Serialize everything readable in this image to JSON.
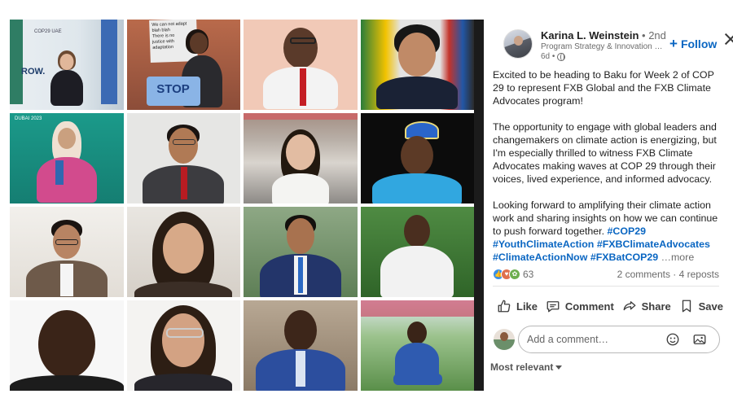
{
  "post": {
    "author": {
      "name": "Karina L. Weinstein",
      "degree": "• 2nd",
      "headline": "Program Strategy & Innovation D...",
      "time": "6d •"
    },
    "follow_label": "Follow",
    "body": {
      "p1": "Excited to be heading to Baku for Week 2 of COP 29 to represent FXB Global and the FXB Climate Advocates program!",
      "p2": "The opportunity to engage with global leaders and changemakers on climate action is energizing, but I'm especially thrilled to witness FXB Climate Advocates making waves at COP 29 through their voices, lived experience, and informed advocacy.",
      "p3": "Looking forward to amplifying their climate action work and sharing insights on how we can continue to push forward together.",
      "hashtags": [
        "#COP29",
        "#YouthClimateAction",
        "#FXBClimateAdvocates",
        "#ClimateActionNow",
        "#FXBatCOP29"
      ],
      "more": "…more"
    },
    "reactions": {
      "count": "63",
      "types": [
        "like-icon",
        "love-icon",
        "support-icon"
      ]
    },
    "engagement": "2 comments · 4 reposts",
    "actions": [
      {
        "key": "like",
        "label": "Like"
      },
      {
        "key": "comment",
        "label": "Comment"
      },
      {
        "key": "share",
        "label": "Share"
      },
      {
        "key": "save",
        "label": "Save"
      }
    ],
    "comment_placeholder": "Add a comment…",
    "sort_label": "Most relevant"
  },
  "photo_tiles": [
    {
      "name": "photo-cop-stage-woman",
      "text_lines": [
        "ROW.",
        "COP29 UAE"
      ]
    },
    {
      "name": "photo-protest-sign-woman",
      "text_lines": [
        "We can not adapt",
        "blah blah",
        "There is no",
        "justice with",
        "adaptation",
        "STOP"
      ]
    },
    {
      "name": "photo-man-red-tie"
    },
    {
      "name": "photo-man-colorful-backdrop"
    },
    {
      "name": "photo-woman-hijab-pink",
      "text_lines": [
        "DUBAI 2023"
      ]
    },
    {
      "name": "photo-young-man-suit"
    },
    {
      "name": "photo-woman-steps"
    },
    {
      "name": "photo-man-blue-cap"
    },
    {
      "name": "photo-man-glasses-blazer"
    },
    {
      "name": "photo-woman-long-hair"
    },
    {
      "name": "photo-man-navy-suit"
    },
    {
      "name": "photo-man-white-shirt"
    },
    {
      "name": "photo-man-portrait"
    },
    {
      "name": "photo-woman-glasses"
    },
    {
      "name": "photo-man-blue-suit"
    },
    {
      "name": "photo-man-seated-garden"
    }
  ],
  "theme": {
    "accent": "#0a66c2",
    "text": "#1f1f1f",
    "muted": "#6b6b6b"
  }
}
